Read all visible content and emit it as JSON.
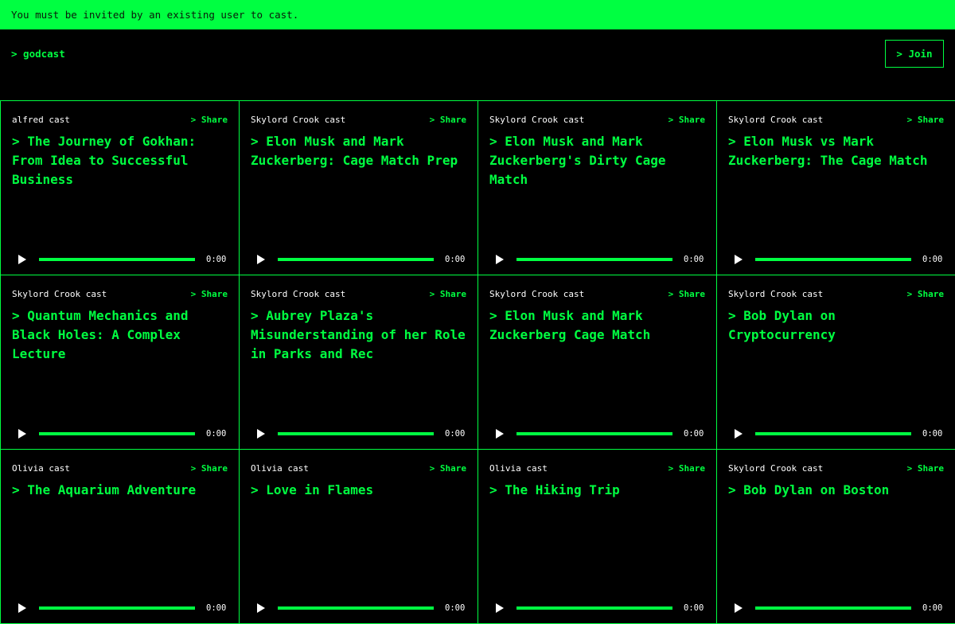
{
  "banner": {
    "text": "You must be invited by an existing user to cast."
  },
  "header": {
    "brand": "> godcast",
    "join_label": "> Join"
  },
  "share_label": "> Share",
  "cards": [
    {
      "author": "alfred cast",
      "title": "> The Journey of Gokhan: From Idea to Successful Business",
      "time": "0:00"
    },
    {
      "author": "Skylord Crook cast",
      "title": "> Elon Musk and Mark Zuckerberg: Cage Match Prep",
      "time": "0:00"
    },
    {
      "author": "Skylord Crook cast",
      "title": "> Elon Musk and Mark Zuckerberg's Dirty Cage Match",
      "time": "0:00"
    },
    {
      "author": "Skylord Crook cast",
      "title": "> Elon Musk vs Mark Zuckerberg: The Cage Match",
      "time": "0:00"
    },
    {
      "author": "Skylord Crook cast",
      "title": "> Quantum Mechanics and Black Holes: A Complex Lecture",
      "time": "0:00"
    },
    {
      "author": "Skylord Crook cast",
      "title": "> Aubrey Plaza's Misunderstanding of her Role in Parks and Rec",
      "time": "0:00"
    },
    {
      "author": "Skylord Crook cast",
      "title": "> Elon Musk and Mark Zuckerberg Cage Match",
      "time": "0:00"
    },
    {
      "author": "Skylord Crook cast",
      "title": "> Bob Dylan on Cryptocurrency",
      "time": "0:00"
    },
    {
      "author": "Olivia cast",
      "title": "> The Aquarium Adventure",
      "time": "0:00"
    },
    {
      "author": "Olivia cast",
      "title": "> Love in Flames",
      "time": "0:00"
    },
    {
      "author": "Olivia cast",
      "title": "> The Hiking Trip",
      "time": "0:00"
    },
    {
      "author": "Skylord Crook cast",
      "title": "> Bob Dylan on Boston",
      "time": "0:00"
    }
  ],
  "colors": {
    "accent": "#00ff41",
    "background": "#000000"
  },
  "icons": {
    "play": "play-icon"
  }
}
